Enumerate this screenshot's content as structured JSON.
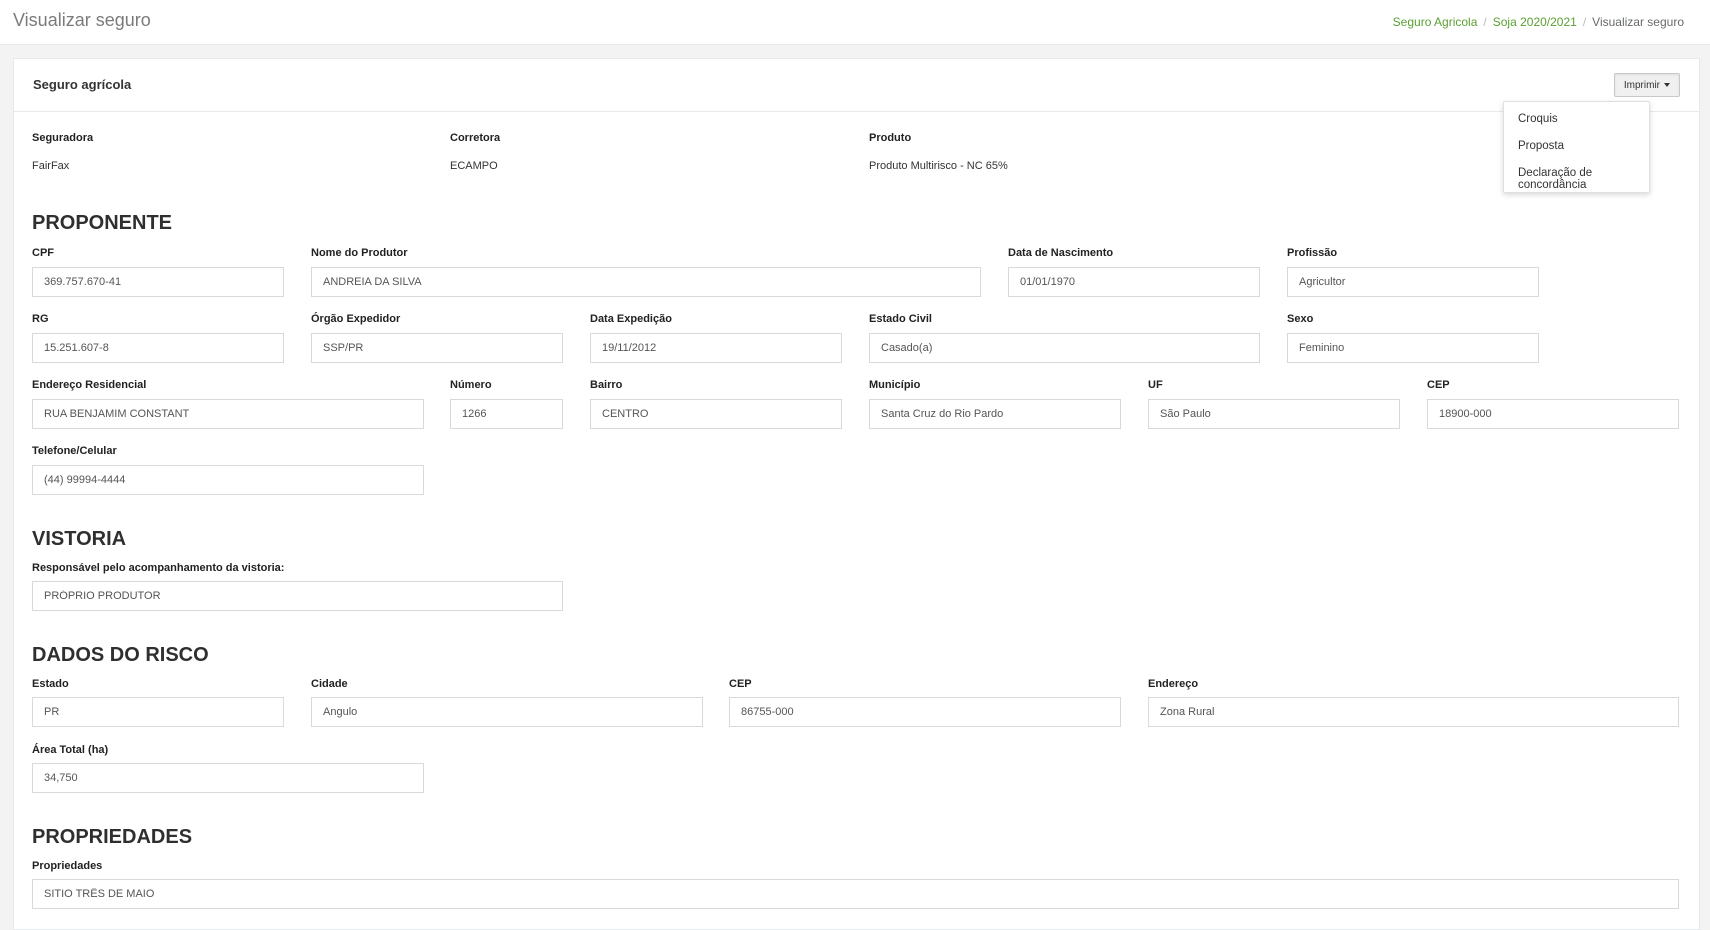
{
  "page": {
    "title": "Visualizar seguro"
  },
  "breadcrumb": {
    "item1": "Seguro Agricola",
    "item2": "Soja 2020/2021",
    "item3": "Visualizar seguro",
    "separator": "/"
  },
  "panel": {
    "title": "Seguro agrícola",
    "print_label": "Imprimir"
  },
  "print_menu": {
    "croquis": "Croquis",
    "proposta": "Proposta",
    "declaracao": "Declaração de concordância"
  },
  "info": {
    "seguradora_label": "Seguradora",
    "seguradora_value": "FairFax",
    "corretora_label": "Corretora",
    "corretora_value": "ECAMPO",
    "produto_label": "Produto",
    "produto_value": "Produto Multirisco - NC 65%"
  },
  "proponente": {
    "heading": "PROPONENTE",
    "cpf_label": "CPF",
    "cpf": "369.757.670-41",
    "nome_label": "Nome do Produtor",
    "nome": "ANDREIA DA SILVA",
    "nasc_label": "Data de Nascimento",
    "nasc": "01/01/1970",
    "prof_label": "Profissão",
    "prof": "Agricultor",
    "rg_label": "RG",
    "rg": "15.251.607-8",
    "orgao_label": "Órgão Expedidor",
    "orgao": "SSP/PR",
    "expedicao_label": "Data Expedição",
    "expedicao": "19/11/2012",
    "estado_civil_label": "Estado Civil",
    "estado_civil": "Casado(a)",
    "sexo_label": "Sexo",
    "sexo": "Feminino",
    "endereco_label": "Endereço Residencial",
    "endereco": "RUA BENJAMIM CONSTANT",
    "numero_label": "Número",
    "numero": "1266",
    "bairro_label": "Bairro",
    "bairro": "CENTRO",
    "municipio_label": "Município",
    "municipio": "Santa Cruz do Rio Pardo",
    "uf_label": "UF",
    "uf": "São Paulo",
    "cep_label": "CEP",
    "cep": "18900-000",
    "telefone_label": "Telefone/Celular",
    "telefone": "(44) 99994-4444"
  },
  "vistoria": {
    "heading": "VISTORIA",
    "responsavel_label": "Responsável pelo acompanhamento da vistoria:",
    "responsavel": "PRÓPRIO PRODUTOR"
  },
  "risco": {
    "heading": "DADOS DO RISCO",
    "estado_label": "Estado",
    "estado": "PR",
    "cidade_label": "Cidade",
    "cidade": "Angulo",
    "cep_label": "CEP",
    "cep": "86755-000",
    "endereco_label": "Endereço",
    "endereco": "Zona Rural",
    "area_label": "Área Total (ha)",
    "area": "34,750"
  },
  "propriedades": {
    "heading": "PROPRIEDADES",
    "label": "Propriedades",
    "value": "SITIO TRÊS DE MAIO"
  }
}
